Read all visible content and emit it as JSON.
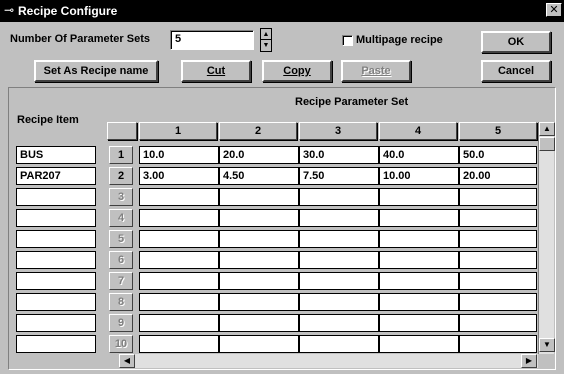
{
  "window": {
    "title": "Recipe Configure",
    "icon": "window-menu-icon",
    "close_glyph": "✕"
  },
  "controls": {
    "num_param_sets_label": "Number Of Parameter Sets",
    "num_param_sets_value": "5",
    "multipage_label": "Multipage recipe",
    "multipage_checked": false,
    "ok_label": "OK",
    "cancel_label": "Cancel",
    "set_as_recipe_name_label": "Set As Recipe name",
    "cut_label": "Cut",
    "copy_label": "Copy",
    "paste_label": "Paste"
  },
  "grid": {
    "recipe_item_header": "Recipe Item",
    "param_set_header": "Recipe Parameter Set",
    "columns": [
      "1",
      "2",
      "3",
      "4",
      "5"
    ],
    "rows": [
      {
        "num": "1",
        "item": "BUS",
        "values": [
          "10.0",
          "20.0",
          "30.0",
          "40.0",
          "50.0"
        ],
        "enabled": true
      },
      {
        "num": "2",
        "item": "PAR207",
        "values": [
          "3.00",
          "4.50",
          "7.50",
          "10.00",
          "20.00"
        ],
        "enabled": true
      },
      {
        "num": "3",
        "item": "",
        "values": [
          "",
          "",
          "",
          "",
          ""
        ],
        "enabled": false
      },
      {
        "num": "4",
        "item": "",
        "values": [
          "",
          "",
          "",
          "",
          ""
        ],
        "enabled": false
      },
      {
        "num": "5",
        "item": "",
        "values": [
          "",
          "",
          "",
          "",
          ""
        ],
        "enabled": false
      },
      {
        "num": "6",
        "item": "",
        "values": [
          "",
          "",
          "",
          "",
          ""
        ],
        "enabled": false
      },
      {
        "num": "7",
        "item": "",
        "values": [
          "",
          "",
          "",
          "",
          ""
        ],
        "enabled": false
      },
      {
        "num": "8",
        "item": "",
        "values": [
          "",
          "",
          "",
          "",
          ""
        ],
        "enabled": false
      },
      {
        "num": "9",
        "item": "",
        "values": [
          "",
          "",
          "",
          "",
          ""
        ],
        "enabled": false
      },
      {
        "num": "10",
        "item": "",
        "values": [
          "",
          "",
          "",
          "",
          ""
        ],
        "enabled": false
      }
    ]
  },
  "scrollbars": {
    "up_glyph": "▲",
    "down_glyph": "▼",
    "left_glyph": "◀",
    "right_glyph": "▶"
  }
}
